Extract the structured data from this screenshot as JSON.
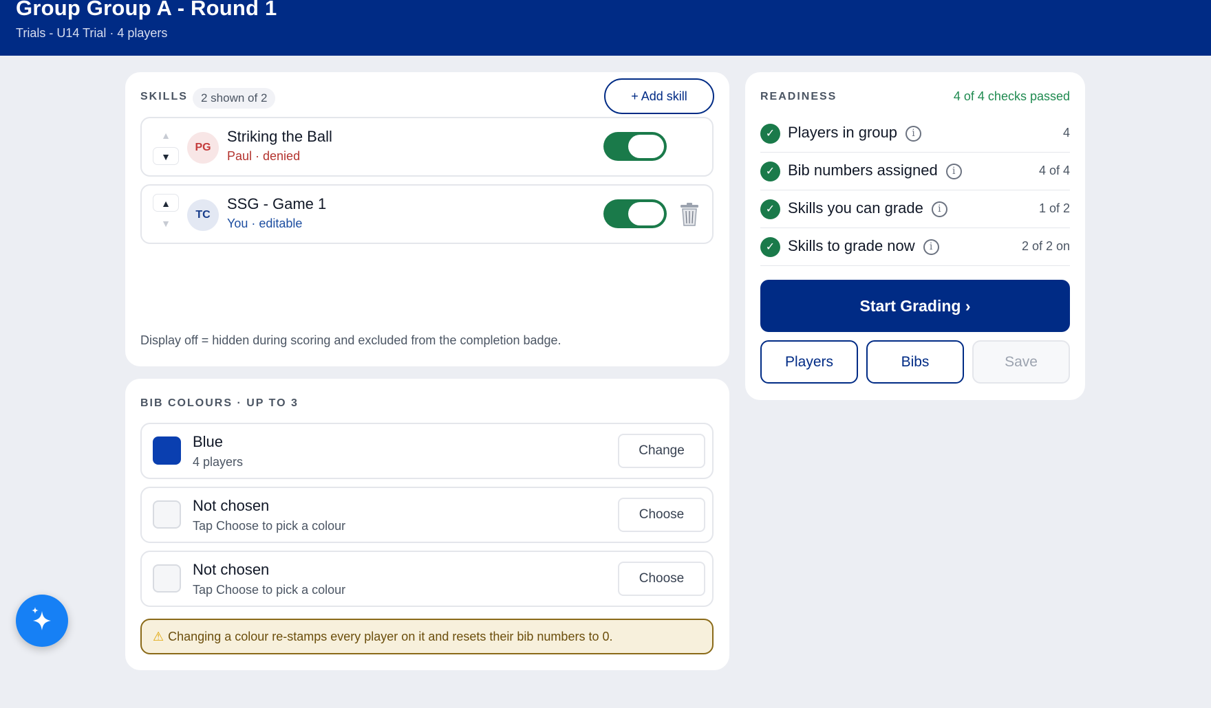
{
  "header": {
    "title": "Group Group A - Round 1",
    "subtitle": "Trials - U14 Trial · 4 players"
  },
  "skills": {
    "section_label": "SKILLS",
    "count_label": "2 shown of 2",
    "add_label": "+ Add skill",
    "items": [
      {
        "name": "Striking the Ball",
        "initials": "PG",
        "meta": "Paul · denied",
        "display_on": true,
        "can_move_up": false,
        "can_move_down": true
      },
      {
        "name": "SSG - Game 1",
        "initials": "TC",
        "meta": "You · editable",
        "display_on": true,
        "can_move_up": true,
        "can_move_down": false
      }
    ],
    "note": "Display off = hidden during scoring and excluded from the completion badge."
  },
  "bibs": {
    "section_label": "BIB COLOURS · UP TO 3",
    "items": [
      {
        "name": "Blue",
        "sub": "4 players",
        "color": "#0a3fb0",
        "button": "Change"
      },
      {
        "name": "Not chosen",
        "sub": "Tap Choose to pick a colour",
        "color": null,
        "button": "Choose"
      },
      {
        "name": "Not chosen",
        "sub": "Tap Choose to pick a colour",
        "color": null,
        "button": "Choose"
      }
    ],
    "warning": "Changing a colour re-stamps every player on it and resets their bib numbers to 0."
  },
  "readiness": {
    "section_label": "READINESS",
    "status": "4 of 4 checks passed",
    "checks": [
      {
        "label": "Players in group",
        "value": "4"
      },
      {
        "label": "Bib numbers assigned",
        "value": "4 of 4"
      },
      {
        "label": "Skills you can grade",
        "value": "1 of 2"
      },
      {
        "label": "Skills to grade now",
        "value": "2 of 2 on"
      }
    ],
    "start_label": "Start Grading  ›",
    "players_label": "Players",
    "bibs_label": "Bibs",
    "save_label": "Save"
  },
  "icons": {
    "fab": "sparkle-icon",
    "check": "check-circle-icon",
    "info": "info-icon",
    "trash": "trash-icon",
    "warning": "warning-icon"
  },
  "colors": {
    "brand": "#002b85",
    "success": "#1a7a4a",
    "fab": "#1680f5"
  }
}
